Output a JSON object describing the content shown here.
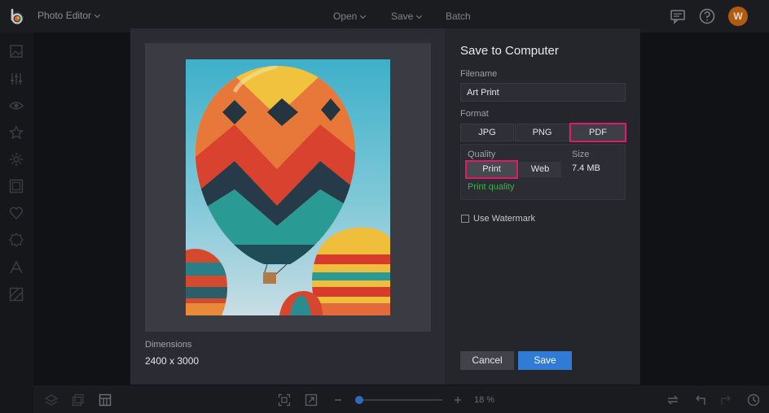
{
  "topbar": {
    "app_title": "Photo Editor",
    "menu": {
      "open": "Open",
      "save": "Save",
      "batch": "Batch"
    },
    "icons": [
      "chat-icon",
      "help-icon"
    ],
    "avatar_initial": "W"
  },
  "left_rail": {
    "icons": [
      "image-icon",
      "adjust-sliders-icon",
      "eye-icon",
      "star-icon",
      "effects-icon",
      "frame-icon",
      "heart-icon",
      "badge-icon",
      "text-icon",
      "texture-icon"
    ]
  },
  "bottom_bar": {
    "icons": [
      "layers-icon",
      "copy-icon",
      "grid-icon",
      "fit-icon",
      "expand-icon",
      "minus-icon",
      "plus-icon",
      "compare-icon",
      "undo-icon",
      "redo-icon",
      "history-icon"
    ],
    "zoom": "18 %",
    "zoom_level": 0.18
  },
  "dialog": {
    "title": "Save to Computer",
    "filename_label": "Filename",
    "filename_value": "Art Print",
    "format_label": "Format",
    "formats": [
      "JPG",
      "PNG",
      "PDF"
    ],
    "selected_format": "PDF",
    "quality_label": "Quality",
    "quality_options": [
      "Print",
      "Web"
    ],
    "selected_quality": "Print",
    "quality_note": "Print quality",
    "size_label": "Size",
    "size_value": "7.4 MB",
    "watermark_label": "Use Watermark",
    "watermark_checked": false,
    "dimensions_label": "Dimensions",
    "dimensions_value": "2400 x 3000",
    "cancel_label": "Cancel",
    "save_label": "Save",
    "accent_color": "#2f7bd6",
    "highlight_color": "#e2186a",
    "note_color": "#3fae4c"
  }
}
